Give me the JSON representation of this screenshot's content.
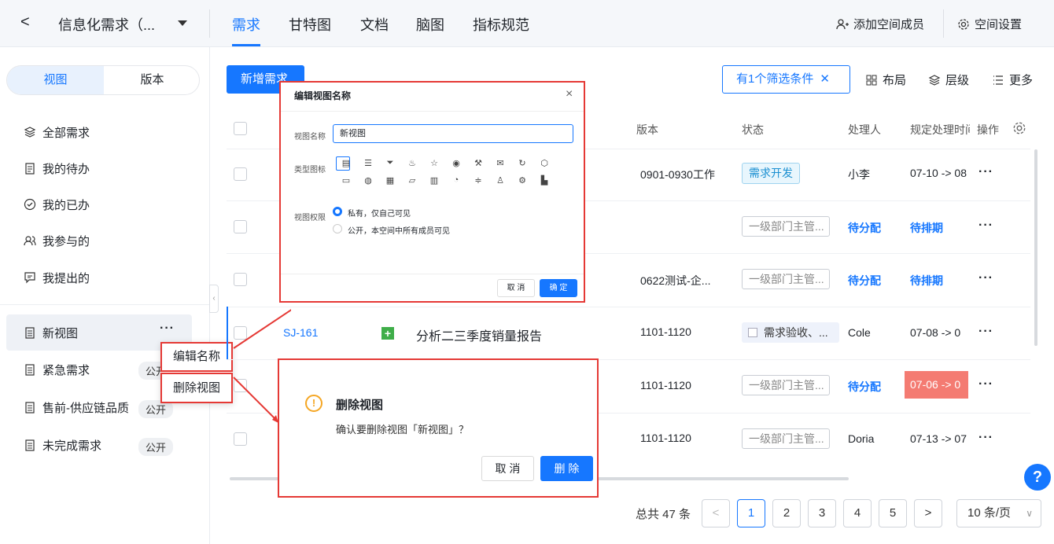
{
  "header": {
    "back": "<",
    "project_title": "信息化需求（...",
    "tabs": [
      "需求",
      "甘特图",
      "文档",
      "脑图",
      "指标规范"
    ],
    "add_member": "添加空间成员",
    "space_settings": "空间设置"
  },
  "sidebar": {
    "seg_view": "视图",
    "seg_version": "版本",
    "items": [
      "全部需求",
      "我的待办",
      "我的已办",
      "我参与的",
      "我提出的"
    ],
    "views": [
      {
        "label": "新视图"
      },
      {
        "label": "紧急需求",
        "badge": "公开"
      },
      {
        "label": "售前-供应链品质",
        "badge": "公开"
      },
      {
        "label": "未完成需求",
        "badge": "公开"
      }
    ],
    "view_more": "···"
  },
  "context_menu": {
    "rename": "编辑名称",
    "delete": "删除视图"
  },
  "toolbar": {
    "new_req": "新增需求",
    "filter": "有1个筛选条件",
    "layout": "布局",
    "level": "层级",
    "more": "更多"
  },
  "table": {
    "headers": {
      "version": "版本",
      "status": "状态",
      "handler": "处理人",
      "due": "规定处理时间",
      "ops": "操作"
    },
    "rows": [
      {
        "version": "0901-0930工作",
        "status": "需求开发",
        "handler": "小李",
        "due": "07-10 -> 08"
      },
      {
        "version": "",
        "status": "一级部门主管...",
        "handler": "待分配",
        "due": "待排期"
      },
      {
        "version": "0622测试-企...",
        "status": "一级部门主管...",
        "handler": "待分配",
        "due": "待排期"
      },
      {
        "id": "SJ-161",
        "title": "分析二三季度销量报告",
        "version": "1101-1120",
        "status": "需求验收、...",
        "handler": "Cole",
        "due": "07-08 -> 0"
      },
      {
        "version": "1101-1120",
        "status": "一级部门主管...",
        "handler": "待分配",
        "due": "07-06 -> 0"
      },
      {
        "version": "1101-1120",
        "status": "一级部门主管...",
        "handler": "Doria",
        "due": "07-13 -> 07"
      }
    ],
    "ops_label": "···"
  },
  "pagination": {
    "total": "总共 47 条",
    "pages": [
      "1",
      "2",
      "3",
      "4",
      "5"
    ],
    "prev": "<",
    "next": ">",
    "size": "10 条/页"
  },
  "edit_dialog": {
    "title": "编辑视图名称",
    "close": "×",
    "name_label": "视图名称",
    "name_value": "新视图",
    "icon_label": "类型图标",
    "perm_label": "视图权限",
    "private": "私有，仅自己可见",
    "public": "公开，本空间中所有成员可见",
    "cancel": "取 消",
    "ok": "确 定"
  },
  "delete_dialog": {
    "title": "删除视图",
    "message": "确认要删除视图「新视图」？",
    "cancel": "取 消",
    "ok": "删 除",
    "warn": "!"
  },
  "help": "?"
}
